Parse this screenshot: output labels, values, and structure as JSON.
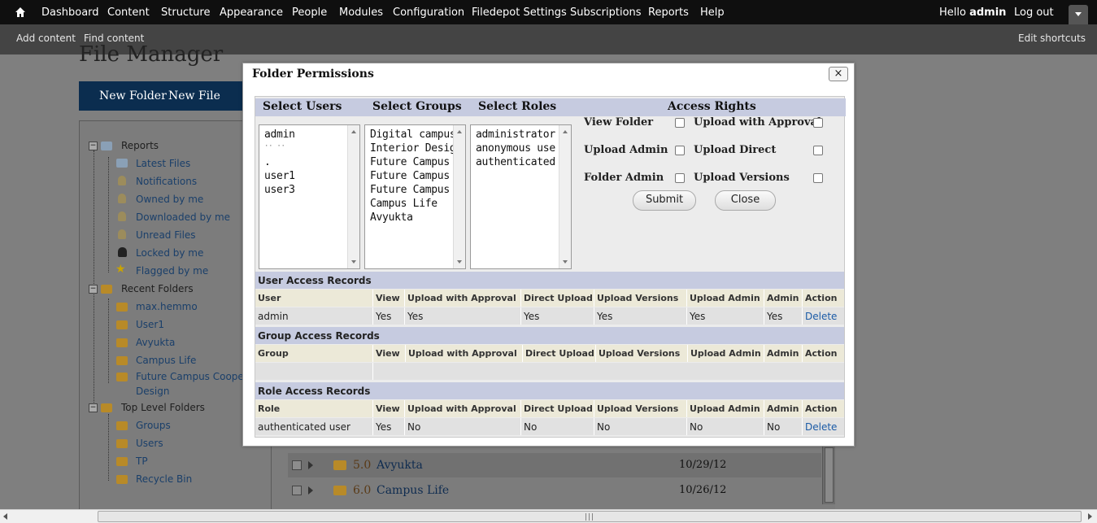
{
  "toolbar": {
    "items": [
      "Dashboard",
      "Content",
      "Structure",
      "Appearance",
      "People",
      "Modules",
      "Configuration",
      "Filedepot Settings",
      "Subscriptions",
      "Reports",
      "Help"
    ],
    "greeting": "Hello",
    "user": "admin",
    "logout": "Log out"
  },
  "shortcuts": {
    "add": "Add content",
    "find": "Find content",
    "edit": "Edit shortcuts"
  },
  "page": {
    "title": "File Manager",
    "new_folder": "New Folder",
    "new_file": "New File"
  },
  "tree": {
    "reports": "Reports",
    "report_items": [
      "Latest Files",
      "Notifications",
      "Owned by me",
      "Downloaded by me",
      "Unread Files",
      "Locked by me",
      "Flagged by me"
    ],
    "recent": "Recent Folders",
    "recent_items": [
      "max.hemmo",
      "User1",
      "Avyukta",
      "Campus Life",
      "Future Campus Cooper",
      "Design"
    ],
    "top": "Top Level Folders",
    "top_items": [
      "Groups",
      "Users",
      "TP",
      "Recycle Bin"
    ]
  },
  "folder_list": [
    {
      "num": "5.0",
      "name": "Avyukta",
      "date": "10/29/12"
    },
    {
      "num": "6.0",
      "name": "Campus Life",
      "date": "10/26/12"
    }
  ],
  "dialog": {
    "title": "Folder Permissions",
    "close_x": "×",
    "headers": {
      "users": "Select Users",
      "groups": "Select Groups",
      "roles": "Select Roles",
      "rights": "Access Rights"
    },
    "users": [
      "admin",
      "·· ··",
      ".",
      "user1",
      "user3"
    ],
    "groups": [
      "Digital campus",
      "Interior Design",
      "Future Campus",
      "Future Campus",
      "Future Campus",
      "Campus Life",
      "Avyukta"
    ],
    "roles": [
      "administrator",
      "anonymous use",
      "authenticated u"
    ],
    "rights": {
      "view_folder": "View Folder",
      "upload_approval": "Upload with Approval",
      "upload_admin": "Upload Admin",
      "upload_direct": "Upload Direct",
      "folder_admin": "Folder Admin",
      "upload_versions": "Upload Versions"
    },
    "submit": "Submit",
    "close": "Close",
    "user_records": {
      "title": "User Access Records",
      "columns": [
        "User",
        "View",
        "Upload with Approval",
        "Direct Upload",
        "Upload Versions",
        "Upload Admin",
        "Admin",
        "Action"
      ],
      "rows": [
        [
          "admin",
          "Yes",
          "Yes",
          "Yes",
          "Yes",
          "Yes",
          "Yes",
          "Delete"
        ]
      ]
    },
    "group_records": {
      "title": "Group Access Records",
      "columns": [
        "Group",
        "View",
        "Upload with Approval",
        "Direct Upload",
        "Upload Versions",
        "Upload Admin",
        "Admin",
        "Action"
      ],
      "rows": [
        [
          "",
          "",
          "",
          "",
          "",
          "",
          "",
          ""
        ]
      ]
    },
    "role_records": {
      "title": "Role Access Records",
      "columns": [
        "Role",
        "View",
        "Upload with Approval",
        "Direct Upload",
        "Upload Versions",
        "Upload Admin",
        "Admin",
        "Action"
      ],
      "rows": [
        [
          "authenticated user",
          "Yes",
          "No",
          "No",
          "No",
          "No",
          "No",
          "Delete"
        ]
      ]
    }
  }
}
